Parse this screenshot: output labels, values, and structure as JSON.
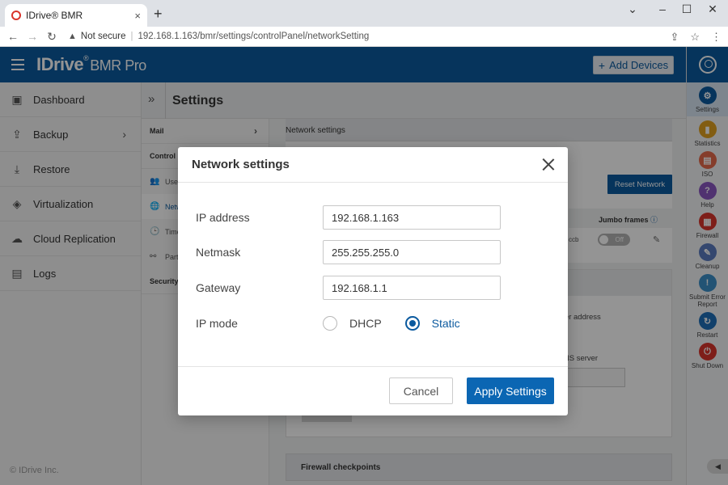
{
  "browser": {
    "tab_title": "IDrive® BMR",
    "tab_close": "×",
    "new_tab": "+",
    "controls": {
      "minimize": "–",
      "maximize": "☐",
      "close": "✕",
      "menu": "⌄"
    },
    "url_warning": "Not secure",
    "url_separator": "|",
    "url": "192.168.1.163/bmr/settings/controlPanel/networkSetting"
  },
  "app": {
    "brand": "IDrive",
    "brand_reg": "®",
    "brand_sub": "BMR Pro",
    "add_devices_plus": "+",
    "add_devices": "Add Devices",
    "footer": "© IDrive Inc."
  },
  "sidebar": {
    "items": [
      {
        "label": "Dashboard",
        "icon": "dashboard-icon"
      },
      {
        "label": "Backup",
        "icon": "backup-icon",
        "chevron": "›"
      },
      {
        "label": "Restore",
        "icon": "restore-icon"
      },
      {
        "label": "Virtualization",
        "icon": "virtualization-icon"
      },
      {
        "label": "Cloud Replication",
        "icon": "cloud-icon"
      },
      {
        "label": "Logs",
        "icon": "logs-icon"
      }
    ]
  },
  "rail": {
    "items": [
      {
        "label": "Settings",
        "color": "#0b5a9f",
        "glyph": "⚙"
      },
      {
        "label": "Statistics",
        "color": "#e0a020",
        "glyph": "▮"
      },
      {
        "label": "ISO",
        "color": "#e66a4b",
        "glyph": "▤"
      },
      {
        "label": "Help",
        "color": "#8a56c2",
        "glyph": "?"
      },
      {
        "label": "Firewall",
        "color": "#d9342b",
        "glyph": "▦"
      },
      {
        "label": "Cleanup",
        "color": "#5b7bbf",
        "glyph": "✎"
      },
      {
        "label": "Submit Error Report",
        "color": "#3b8fc9",
        "glyph": "!"
      },
      {
        "label": "Restart",
        "color": "#1e6fb8",
        "glyph": "↻"
      },
      {
        "label": "Shut Down",
        "color": "#d9342b",
        "glyph": "⏻"
      }
    ],
    "collapse": "◀"
  },
  "settings": {
    "collapse_glyph": "»",
    "title": "Settings",
    "subnav": {
      "mail": "Mail",
      "mail_chevron": "›",
      "control_panel": "Control P",
      "items": [
        {
          "label": "Use",
          "glyph": "👥"
        },
        {
          "label": "Netw",
          "glyph": "🌐"
        },
        {
          "label": "Time",
          "glyph": "🕒"
        },
        {
          "label": "Part",
          "glyph": "⚯"
        }
      ],
      "security": "Security"
    },
    "network_head": "Network settings",
    "reset_network": "Reset Network",
    "jumbo_frames": "Jumbo frames",
    "jumbo_info": "ⓘ",
    "mac_fragment": "ccb",
    "toggle_off": "Off",
    "edit_glyph": "✎",
    "server_address": "rver address",
    "dns_server": "DNS server",
    "firewall_checkpoints": "Firewall checkpoints"
  },
  "modal": {
    "title": "Network settings",
    "fields": {
      "ip_label": "IP address",
      "ip_value": "192.168.1.163",
      "netmask_label": "Netmask",
      "netmask_value": "255.255.255.0",
      "gateway_label": "Gateway",
      "gateway_value": "192.168.1.1",
      "ipmode_label": "IP mode",
      "dhcp": "DHCP",
      "static": "Static"
    },
    "cancel": "Cancel",
    "apply": "Apply Settings"
  }
}
